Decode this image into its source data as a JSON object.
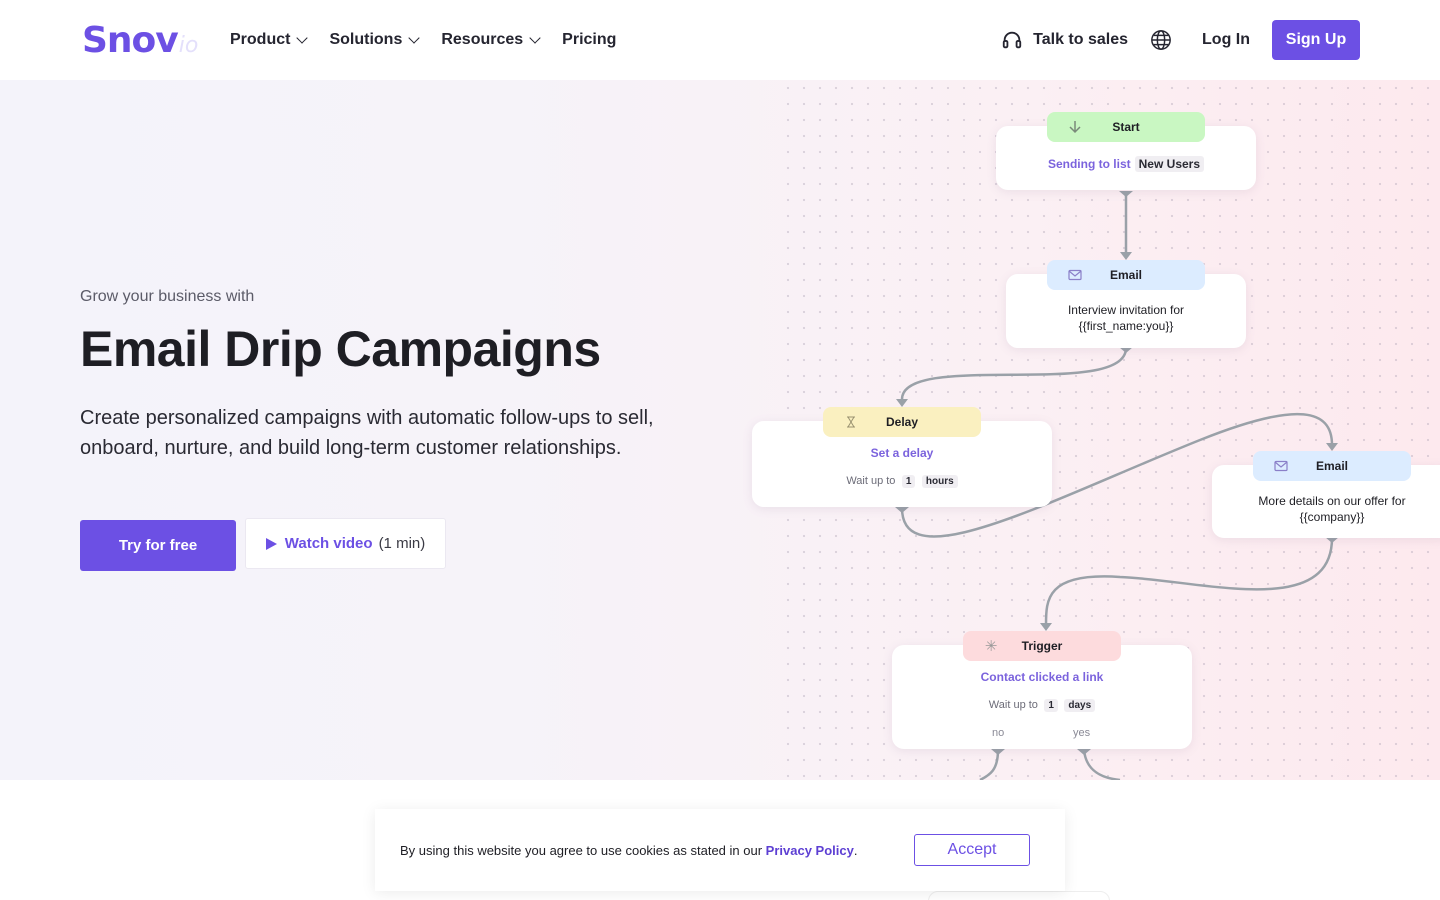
{
  "header": {
    "logo_main": "Snov",
    "logo_sub": "io",
    "nav": [
      {
        "label": "Product"
      },
      {
        "label": "Solutions"
      },
      {
        "label": "Resources"
      },
      {
        "label": "Pricing"
      }
    ],
    "talk_to_sales": "Talk to sales",
    "login": "Log In",
    "signup": "Sign Up"
  },
  "hero": {
    "eyebrow": "Grow your business with",
    "title": "Email Drip Campaigns",
    "description": "Create personalized campaigns with automatic follow-ups to sell, onboard, nurture, and build long-term customer relationships.",
    "try_button": "Try for free",
    "video_button": "Watch video",
    "video_duration": "(1 min)"
  },
  "flow": {
    "start": {
      "head": "Start",
      "text": "Sending to list",
      "chip": "New Users"
    },
    "email1": {
      "head": "Email",
      "line1": "Interview invitation for",
      "line2": "{{first_name:you}}"
    },
    "delay": {
      "head": "Delay",
      "link": "Set a delay",
      "wait": "Wait up to",
      "num": "1",
      "unit": "hours"
    },
    "email2": {
      "head": "Email",
      "line1": "More details on our offer for",
      "line2": "{{company}}"
    },
    "trigger": {
      "head": "Trigger",
      "link": "Contact clicked a link",
      "wait": "Wait up to",
      "num": "1",
      "unit": "days",
      "no": "no",
      "yes": "yes"
    }
  },
  "cookie": {
    "text": "By using this website you agree to use cookies as stated in our",
    "link": "Privacy Policy",
    "period": ".",
    "accept": "Accept"
  },
  "colors": {
    "accent": "#6c50e4",
    "start": "#c9f7c2",
    "email": "#dcecff",
    "delay": "#faf0c0",
    "trigger": "#fddbdd"
  }
}
